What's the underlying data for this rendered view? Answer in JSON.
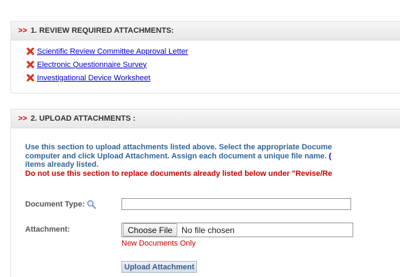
{
  "section1": {
    "arrows": ">>",
    "title": "1. REVIEW REQUIRED ATTACHMENTS:",
    "items": [
      {
        "label": "Scientific Review Committee Approval Letter",
        "icon": "red-x-icon"
      },
      {
        "label": "Electronic Questionnaire Survey",
        "icon": "red-x-icon"
      },
      {
        "label": "Investigational Device Worksheet",
        "icon": "red-x-icon"
      }
    ]
  },
  "section2": {
    "arrows": ">>",
    "title": "2. UPLOAD ATTACHMENTS :",
    "instructions": {
      "line1": "Use this section to upload attachments listed above. Select the appropriate Docume",
      "line2": "computer and click Upload Attachment. Assign each document a unique file name.",
      "line2_link": "(",
      "line3": "items already listed.",
      "warning": "Do not use this section to replace documents already listed below under \"Revise/Re"
    },
    "document_type_label": "Document Type:",
    "document_type_value": "",
    "attachment_label": "Attachment:",
    "choose_file_label": "Choose File",
    "no_file_text": "No file chosen",
    "new_documents_note": "New Documents Only",
    "upload_button_label": "Upload Attachment"
  },
  "colors": {
    "header_arrows": "#cc0000",
    "link": "#0000cc",
    "instructions": "#336699",
    "warning": "#cc0000"
  }
}
